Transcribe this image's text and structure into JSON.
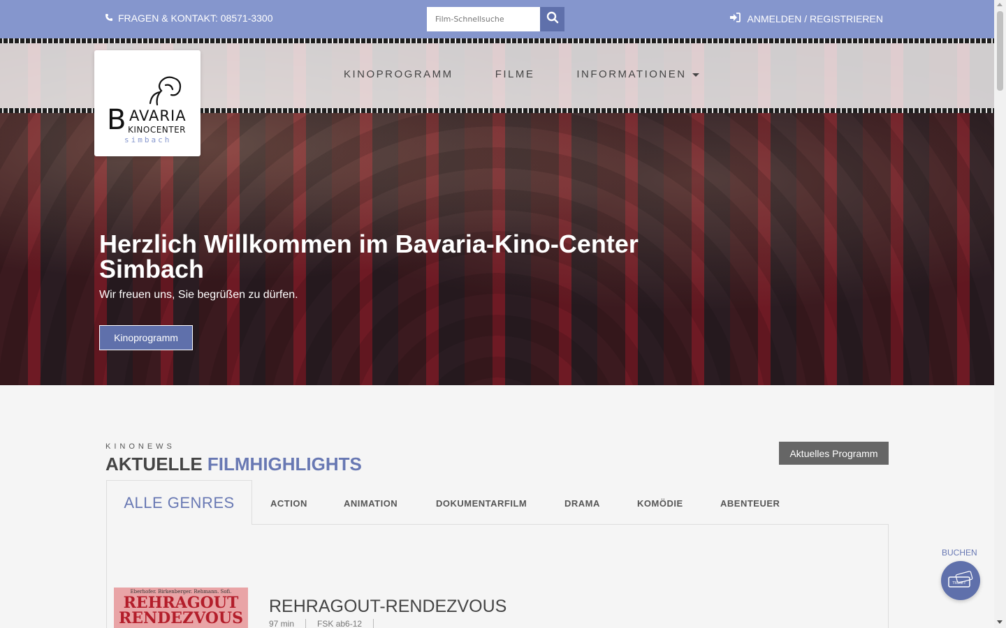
{
  "topbar": {
    "contact_text": "FRAGEN & KONTAKT: 08571-3300",
    "search_placeholder": "Film-Schnellsuche",
    "login_text": "ANMELDEN / REGISTRIEREN"
  },
  "logo": {
    "big_letter": "B",
    "word": "AVARIA",
    "line2": "KINOCENTER",
    "line3": "simbach"
  },
  "nav": [
    {
      "label": "KINOPROGRAMM"
    },
    {
      "label": "FILME"
    },
    {
      "label": "INFORMATIONEN"
    }
  ],
  "hero": {
    "title": "Herzlich Willkommen im Bavaria-Kino-Center Simbach",
    "subtitle": "Wir freuen uns, Sie begrüßen zu dürfen.",
    "button": "Kinoprogramm"
  },
  "news": {
    "kicker": "KINONEWS",
    "title_part1": "AKTUELLE",
    "title_part2": "FILMHIGHLIGHTS",
    "program_button": "Aktuelles Programm",
    "tabs": [
      "ALLE GENRES",
      "ACTION",
      "ANIMATION",
      "DOKUMENTARFILM",
      "DRAMA",
      "KOMÖDIE",
      "ABENTEUER"
    ]
  },
  "film": {
    "poster_top": "Eberhofer. Birkenberger. Rehmann. Sofi.",
    "poster_title": "REHRAGOUT RENDEZVOUS",
    "title": "REHRAGOUT-RENDEZVOUS",
    "duration": "97 min",
    "fsk": "FSK ab6-12"
  },
  "booking": {
    "label": "BUCHEN",
    "icon_text": "TICKET"
  },
  "colors": {
    "accent": "#8596cd",
    "accent_dark": "#5f70ab",
    "highlight_text": "#6878b3"
  }
}
